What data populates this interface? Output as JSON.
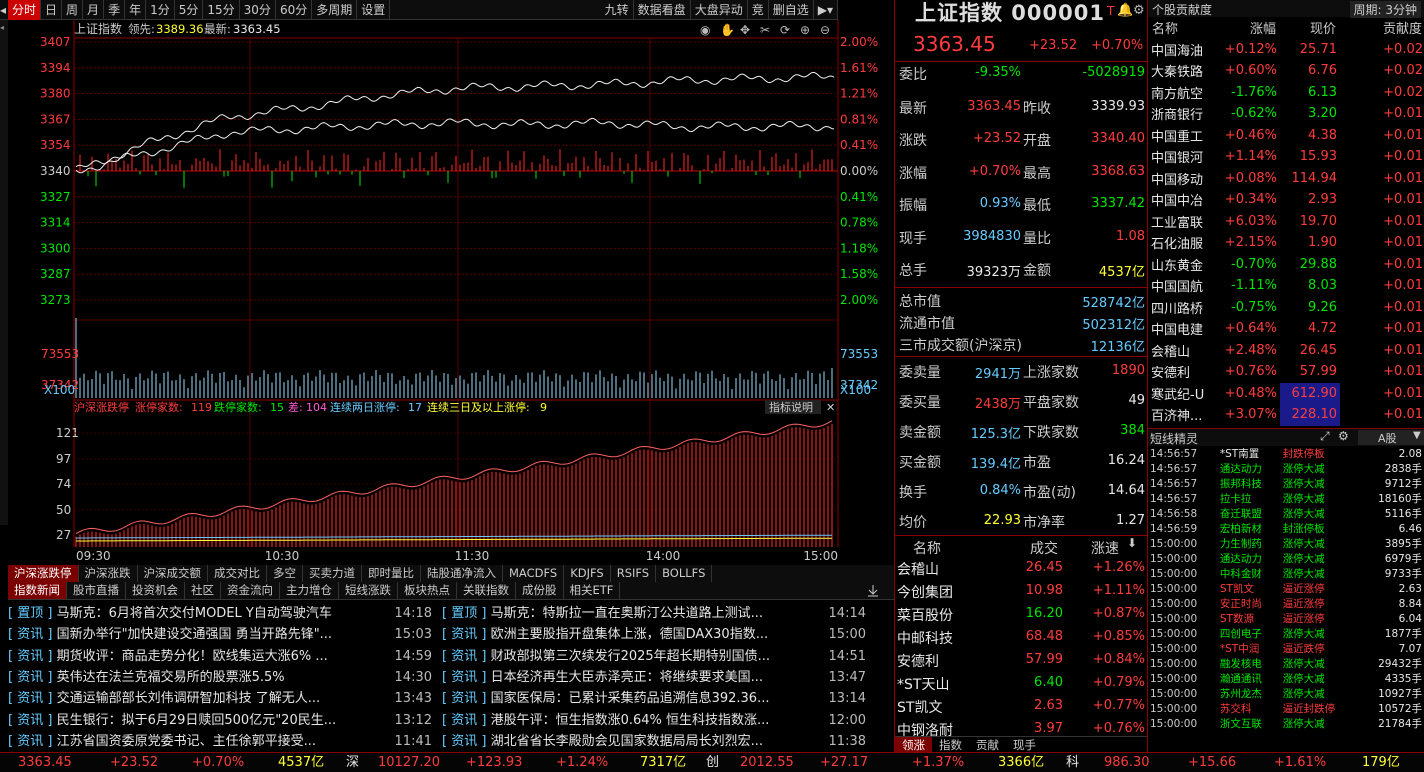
{
  "toolbar": {
    "tabs": [
      "分时",
      "日",
      "周",
      "月",
      "季",
      "年",
      "1分",
      "5分",
      "15分",
      "30分",
      "60分",
      "多周期",
      "设置"
    ],
    "right": [
      "九转",
      "数据看盘",
      "大盘异动",
      "竞",
      "删自选"
    ]
  },
  "chart": {
    "header": {
      "name": "上证指数",
      "lead_label": "领先:",
      "lead": "3389.36",
      "last_label": "最新:",
      "last": "3363.45"
    },
    "price_ticks": [
      "3407",
      "3394",
      "3380",
      "3367",
      "3354",
      "3340",
      "3327",
      "3314",
      "3300",
      "3287",
      "3273"
    ],
    "pct_ticks": [
      "2.00%",
      "1.61%",
      "1.21%",
      "0.81%",
      "0.41%",
      "0.00%",
      "0.41%",
      "0.78%",
      "1.18%",
      "1.58%",
      "2.00%"
    ],
    "vol_ticks": [
      "73553",
      "37342"
    ],
    "vol_unit": "X100",
    "limit_header": {
      "name": "沪深涨跌停",
      "limitup_label": "涨停家数:",
      "limitup": "119",
      "limitdown_label": "跌停家数:",
      "limitdown": "15",
      "diff_label": "差:",
      "diff": "104",
      "two_label": "连续两日涨停:",
      "two": "17",
      "three_label": "连续三日及以上涨停:",
      "three": "9"
    },
    "explain": "指标说明",
    "limit_ticks": [
      "121",
      "97",
      "74",
      "50",
      "27"
    ],
    "time_ticks": [
      "09:30",
      "10:30",
      "11:30",
      "14:00",
      "15:00"
    ]
  },
  "chart_data": {
    "type": "line",
    "series": [
      {
        "values": [
          3340,
          3355,
          3368,
          3373,
          3379,
          3383,
          3384,
          3385,
          3387,
          3388,
          3389
        ]
      },
      {
        "values": [
          3340,
          3350,
          3360,
          3362,
          3364,
          3365,
          3364,
          3365,
          3363,
          3363,
          3363.45
        ]
      }
    ],
    "ylim": [
      3273,
      3407
    ]
  },
  "tabs1": [
    "沪深涨跌停",
    "沪深涨跌",
    "沪深成交额",
    "成交对比",
    "多空",
    "买卖力道",
    "即时量比",
    "陆股通净流入",
    "MACDFS",
    "KDJFS",
    "RSIFS",
    "BOLLFS"
  ],
  "tabs2": [
    "指数新闻",
    "股市直播",
    "投资机会",
    "社区",
    "资金流向",
    "主力增仓",
    "短线涨跌",
    "板块热点",
    "关联指数",
    "成份股",
    "相关ETF"
  ],
  "news_left": [
    {
      "tag": "置顶",
      "title": "马斯克：6月将首次交付MODEL Y自动驾驶汽车",
      "time": "14:18"
    },
    {
      "tag": "资讯",
      "title": "国新办举行\"加快建设交通强国 勇当开路先锋\"...",
      "time": "15:03"
    },
    {
      "tag": "资讯",
      "title": "期货收评：商品走势分化！欧线集运大涨6%  ...",
      "time": "14:59"
    },
    {
      "tag": "资讯",
      "title": "英伟达在法兰克福交易所的股票涨5.5%",
      "time": "14:30"
    },
    {
      "tag": "资讯",
      "title": "交通运输部部长刘伟调研智加科技 了解无人...",
      "time": "13:43"
    },
    {
      "tag": "资讯",
      "title": "民生银行：拟于6月29日赎回500亿元\"20民生...",
      "time": "13:12"
    },
    {
      "tag": "资讯",
      "title": "江苏省国资委原党委书记、主任徐郭平接受...",
      "time": "11:41"
    }
  ],
  "news_right": [
    {
      "tag": "置顶",
      "title": "马斯克：特斯拉一直在奥斯汀公共道路上测试...",
      "time": "14:14"
    },
    {
      "tag": "资讯",
      "title": "欧洲主要股指开盘集体上涨，德国DAX30指数...",
      "time": "15:00"
    },
    {
      "tag": "资讯",
      "title": "财政部拟第三次续发行2025年超长期特别国债...",
      "time": "14:51"
    },
    {
      "tag": "资讯",
      "title": "日本经济再生大臣赤泽亮正：将继续要求美国...",
      "time": "13:47"
    },
    {
      "tag": "资讯",
      "title": "国家医保局：已累计采集药品追溯信息392.36...",
      "time": "13:14"
    },
    {
      "tag": "资讯",
      "title": "港股午评：恒生指数涨0.64% 恒生科技指数涨...",
      "time": "12:00"
    },
    {
      "tag": "资讯",
      "title": "湖北省省长李殿勋会见国家数据局局长刘烈宏...",
      "time": "11:38"
    }
  ],
  "quote": {
    "title": "上证指数 000001",
    "price": "3363.45",
    "change": "+23.52",
    "pct": "+0.70%",
    "rows": [
      {
        "l1": "委比",
        "v1": "-9.35%",
        "l2": "",
        "v2": "-5028919"
      },
      {
        "l1": "最新",
        "v1": "3363.45",
        "l2": "昨收",
        "v2": "3339.93"
      },
      {
        "l1": "涨跌",
        "v1": "+23.52",
        "l2": "开盘",
        "v2": "3340.40"
      },
      {
        "l1": "涨幅",
        "v1": "+0.70%",
        "l2": "最高",
        "v2": "3368.63"
      },
      {
        "l1": "振幅",
        "v1": "0.93%",
        "l2": "最低",
        "v2": "3337.42"
      },
      {
        "l1": "现手",
        "v1": "3984830",
        "l2": "量比",
        "v2": "1.08"
      },
      {
        "l1": "总手",
        "v1": "39323万",
        "l2": "金额",
        "v2": "4537亿"
      }
    ],
    "caps": [
      {
        "l": "总市值",
        "v": "528742亿"
      },
      {
        "l": "流通市值",
        "v": "502312亿"
      },
      {
        "l": "三市成交额(沪深京)",
        "v": "12136亿"
      }
    ],
    "breadth": [
      {
        "l1": "委卖量",
        "v1": "2941万",
        "l2": "上涨家数",
        "v2": "1890"
      },
      {
        "l1": "委买量",
        "v1": "2438万",
        "l2": "平盘家数",
        "v2": "49"
      },
      {
        "l1": "卖金额",
        "v1": "125.3亿",
        "l2": "下跌家数",
        "v2": "384"
      },
      {
        "l1": "买金额",
        "v1": "139.4亿",
        "l2": "市盈",
        "v2": "16.24"
      },
      {
        "l1": "换手",
        "v1": "0.84%",
        "l2": "市盈(动)",
        "v2": "14.64"
      },
      {
        "l1": "均价",
        "v1": "22.93",
        "l2": "市净率",
        "v2": "1.27"
      }
    ]
  },
  "leaders": {
    "h_name": "名称",
    "h_vol": "成交",
    "h_speed": "涨速",
    "rows": [
      {
        "name": "会稽山",
        "vol": "26.45",
        "speed": "+1.26%"
      },
      {
        "name": "今创集团",
        "vol": "10.98",
        "speed": "+1.11%"
      },
      {
        "name": "菜百股份",
        "vol": "16.20",
        "speed": "+0.87%"
      },
      {
        "name": "中邮科技",
        "vol": "68.48",
        "speed": "+0.85%"
      },
      {
        "name": "安德利",
        "vol": "57.99",
        "speed": "+0.84%"
      },
      {
        "name": "*ST天山",
        "vol": "6.40",
        "speed": "+0.79%"
      },
      {
        "name": "ST凯文",
        "vol": "2.63",
        "speed": "+0.77%"
      },
      {
        "name": "中钢洛耐",
        "vol": "3.97",
        "speed": "+0.76%"
      }
    ],
    "tabs": [
      "领涨",
      "指数",
      "贡献",
      "现手"
    ]
  },
  "contrib": {
    "title": "个股贡献度",
    "period": "周期: 3分钟",
    "h": [
      "名称",
      "涨幅",
      "现价",
      "贡献度"
    ],
    "rows": [
      [
        "中国海油",
        "+0.12%",
        "25.71",
        "+0.02"
      ],
      [
        "大秦铁路",
        "+0.60%",
        "6.76",
        "+0.02"
      ],
      [
        "南方航空",
        "-1.76%",
        "6.13",
        "+0.02"
      ],
      [
        "浙商银行",
        "-0.62%",
        "3.20",
        "+0.01"
      ],
      [
        "中国重工",
        "+0.46%",
        "4.38",
        "+0.01"
      ],
      [
        "中国银河",
        "+1.14%",
        "15.93",
        "+0.01"
      ],
      [
        "中国移动",
        "+0.08%",
        "114.94",
        "+0.01"
      ],
      [
        "中国中冶",
        "+0.34%",
        "2.93",
        "+0.01"
      ],
      [
        "工业富联",
        "+6.03%",
        "19.70",
        "+0.01"
      ],
      [
        "石化油服",
        "+2.15%",
        "1.90",
        "+0.01"
      ],
      [
        "山东黄金",
        "-0.70%",
        "29.88",
        "+0.01"
      ],
      [
        "中国国航",
        "-1.11%",
        "8.03",
        "+0.01"
      ],
      [
        "四川路桥",
        "-0.75%",
        "9.26",
        "+0.01"
      ],
      [
        "中国电建",
        "+0.64%",
        "4.72",
        "+0.01"
      ],
      [
        "会稽山",
        "+2.48%",
        "26.45",
        "+0.01"
      ],
      [
        "安德利",
        "+0.76%",
        "57.99",
        "+0.01"
      ],
      [
        "寒武纪-U",
        "+0.48%",
        "612.90",
        "+0.01"
      ],
      [
        "百济神...",
        "+3.07%",
        "228.10",
        "+0.01"
      ]
    ]
  },
  "flash": {
    "title": "短线精灵",
    "board": "A股",
    "rows": [
      [
        "14:56:57",
        "*ST南置",
        "封跌停板",
        "2.08"
      ],
      [
        "14:56:57",
        "通达动力",
        "涨停大减",
        "2838手"
      ],
      [
        "14:56:57",
        "振邦科技",
        "涨停大减",
        "9712手"
      ],
      [
        "14:56:57",
        "拉卡拉",
        "涨停大减",
        "18160手"
      ],
      [
        "14:56:58",
        "奋迁联盟",
        "涨停大减",
        "5116手"
      ],
      [
        "14:56:59",
        "宏柏新材",
        "封涨停板",
        "6.46"
      ],
      [
        "15:00:00",
        "力生制药",
        "涨停大减",
        "3895手"
      ],
      [
        "15:00:00",
        "通达动力",
        "涨停大减",
        "6979手"
      ],
      [
        "15:00:00",
        "中科金财",
        "涨停大减",
        "9733手"
      ],
      [
        "15:00:00",
        "ST凯文",
        "逼近涨停",
        "2.63"
      ],
      [
        "15:00:00",
        "安正时尚",
        "逼近涨停",
        "8.84"
      ],
      [
        "15:00:00",
        "ST数源",
        "逼近涨停",
        "6.04"
      ],
      [
        "15:00:00",
        "四创电子",
        "涨停大减",
        "1877手"
      ],
      [
        "15:00:00",
        "*ST中润",
        "逼近跌停",
        "7.07"
      ],
      [
        "15:00:00",
        "融发核电",
        "涨停大减",
        "29432手"
      ],
      [
        "15:00:00",
        "瀚通通讯",
        "涨停大减",
        "4335手"
      ],
      [
        "15:00:00",
        "苏州龙杰",
        "涨停大减",
        "10927手"
      ],
      [
        "15:00:00",
        "苏交科",
        "逼近封跌停",
        "10572手"
      ],
      [
        "15:00:00",
        "浙文互联",
        "涨停大减",
        "21784手"
      ]
    ]
  },
  "status": {
    "sh_price": "3363.45",
    "sh_chg": "+23.52",
    "sh_pct": "+0.70%",
    "sh_amt": "4537亿",
    "sz_label": "深",
    "sz_price": "10127.20",
    "sz_chg": "+123.93",
    "sz_pct": "+1.24%",
    "sz_amt": "7317亿",
    "cy_label": "创",
    "cy_price": "2012.55",
    "cy_chg": "+27.17",
    "cy_pct": "+1.37%",
    "cy_amt": "3366亿",
    "kc_label": "科",
    "kc_price": "986.30",
    "kc_chg": "+15.66",
    "kc_pct": "+1.61%",
    "kc_amt": "179亿"
  }
}
